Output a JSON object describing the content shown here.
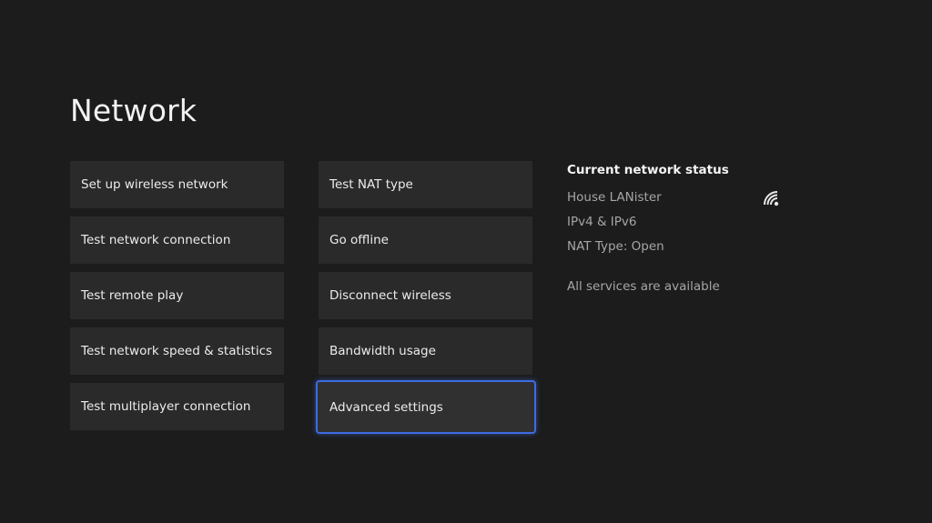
{
  "page": {
    "title": "Network"
  },
  "menu": {
    "left_column": [
      {
        "label": "Set up wireless network"
      },
      {
        "label": "Test network connection"
      },
      {
        "label": "Test remote play"
      },
      {
        "label": "Test network speed & statistics"
      },
      {
        "label": "Test multiplayer connection"
      }
    ],
    "right_column": [
      {
        "label": "Test NAT type"
      },
      {
        "label": "Go offline"
      },
      {
        "label": "Disconnect wireless"
      },
      {
        "label": "Bandwidth usage"
      },
      {
        "label": "Advanced settings",
        "focused": true
      }
    ]
  },
  "status": {
    "heading": "Current network status",
    "network_name": "House LANister",
    "network_icon": "wifi-icon",
    "ip_version": "IPv4 & IPv6",
    "nat_type": "NAT Type: Open",
    "services": "All services are available"
  },
  "colors": {
    "background": "#1c1c1c",
    "tile": "#2a2a2a",
    "focus_accent": "#3e6be0",
    "secondary_text": "#a6a6a6"
  }
}
